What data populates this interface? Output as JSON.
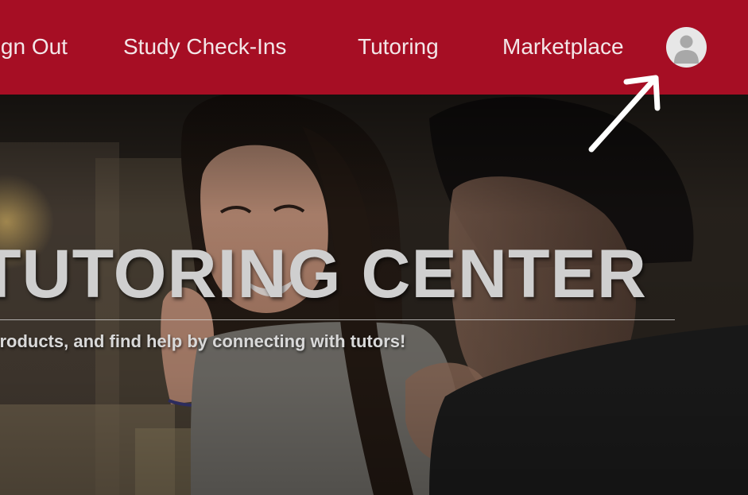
{
  "nav": {
    "links": [
      {
        "label": "Sign Out"
      },
      {
        "label": "Study Check-Ins"
      },
      {
        "label": "Tutoring"
      },
      {
        "label": "Marketplace"
      }
    ],
    "avatar_icon": "user-avatar-icon"
  },
  "hero": {
    "title": "TUTORING CENTER",
    "subtitle": "products, and find help by connecting with tutors!"
  },
  "colors": {
    "navbar_bg": "#a60e24",
    "nav_text": "#f3e6e8",
    "avatar_bg": "#e7e7e7",
    "avatar_figure": "#a8a8a8",
    "hero_title": "#cfcfcf",
    "annotation_arrow": "#ffffff"
  },
  "annotation": {
    "icon": "arrow-pointer-icon",
    "points_to": "profile-avatar"
  }
}
